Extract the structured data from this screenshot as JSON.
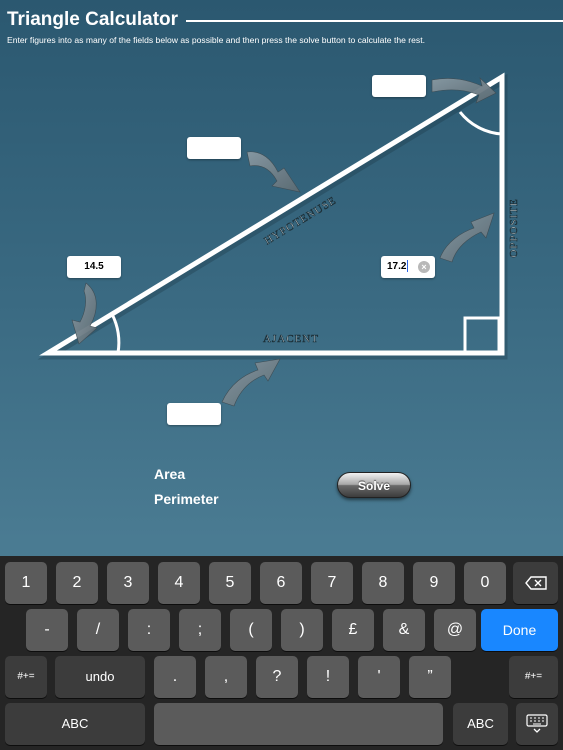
{
  "header": {
    "title": "Triangle Calculator",
    "instructions": "Enter figures into as many of the fields below as possible and then press the solve button to calculate the rest."
  },
  "diagram": {
    "hypotenuse_label": "HYPOTENUSE",
    "adjacent_label": "AJACENT",
    "opposite_label": "OPPOSITE"
  },
  "fields": {
    "top_angle": "",
    "hypotenuse": "",
    "bottom_angle": "14.5",
    "opposite": "17.2",
    "adjacent": ""
  },
  "results": {
    "area_label": "Area",
    "perimeter_label": "Perimeter"
  },
  "solve_label": "Solve",
  "keyboard": {
    "row1": [
      "1",
      "2",
      "3",
      "4",
      "5",
      "6",
      "7",
      "8",
      "9",
      "0"
    ],
    "row2": [
      "-",
      "/",
      ":",
      ";",
      "(",
      ")",
      "£",
      "&",
      "@"
    ],
    "done": "Done",
    "row3_left": "#+=",
    "undo": "undo",
    "row3": [
      ".",
      ",",
      "?",
      "!",
      "'",
      "”"
    ],
    "row3_right": "#+=",
    "abc_left": "ABC",
    "abc_right": "ABC"
  }
}
